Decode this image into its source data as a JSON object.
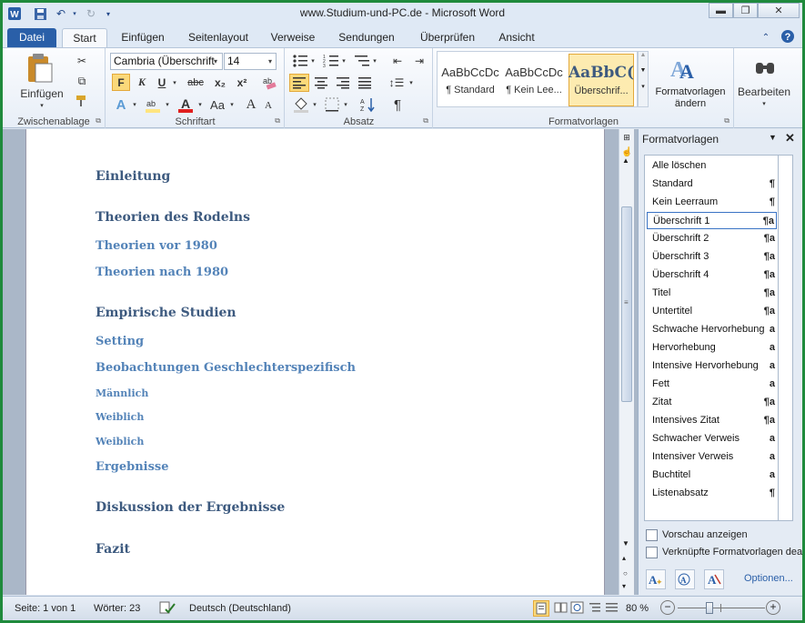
{
  "window": {
    "title": "www.Studium-und-PC.de  -  Microsoft Word"
  },
  "tabs": [
    "Datei",
    "Start",
    "Einfügen",
    "Seitenlayout",
    "Verweise",
    "Sendungen",
    "Überprüfen",
    "Ansicht"
  ],
  "ribbon": {
    "clipboard": {
      "paste_label": "Einfügen",
      "group_label": "Zwischenablage"
    },
    "font": {
      "font_name": "Cambria (Überschrift",
      "font_size": "14",
      "group_label": "Schriftart",
      "bold": "F",
      "italic": "K",
      "underline": "U",
      "strike": "abc",
      "sub": "x₂",
      "sup": "x²",
      "grow": "A",
      "shrink": "A",
      "case": "Aa"
    },
    "paragraph": {
      "group_label": "Absatz",
      "pilcrow": "¶"
    },
    "styles": {
      "group_label": "Formatvorlagen",
      "gallery": [
        {
          "preview": "AaBbCcDc",
          "name": "¶ Standard"
        },
        {
          "preview": "AaBbCcDc",
          "name": "¶ Kein Lee..."
        },
        {
          "preview": "AaBbC(",
          "name": "Überschrif..."
        }
      ],
      "change_styles_label": "Formatvorlagen ändern"
    },
    "editing": {
      "label": "Bearbeiten"
    }
  },
  "document": {
    "headings": [
      {
        "text": "Einleitung",
        "level": 1
      },
      {
        "text": "Theorien des Rodelns",
        "level": 1
      },
      {
        "text": "Theorien vor 1980",
        "level": 2
      },
      {
        "text": "Theorien nach 1980",
        "level": 2
      },
      {
        "text": "Empirische Studien",
        "level": 1
      },
      {
        "text": "Setting",
        "level": 2
      },
      {
        "text": "Beobachtungen Geschlechterspezifisch",
        "level": 2
      },
      {
        "text": "Männlich",
        "level": 3
      },
      {
        "text": "Weiblich",
        "level": 3
      },
      {
        "text": "Weiblich",
        "level": 3
      },
      {
        "text": "Ergebnisse",
        "level": 2
      },
      {
        "text": "Diskussion der Ergebnisse",
        "level": 1
      },
      {
        "text": "Fazit",
        "level": 1
      }
    ]
  },
  "styles_pane": {
    "title": "Formatvorlagen",
    "items": [
      {
        "name": "Alle löschen",
        "symbol": ""
      },
      {
        "name": "Standard",
        "symbol": "¶"
      },
      {
        "name": "Kein Leerraum",
        "symbol": "¶"
      },
      {
        "name": "Überschrift 1",
        "symbol": "¶a"
      },
      {
        "name": "Überschrift 2",
        "symbol": "¶a"
      },
      {
        "name": "Überschrift 3",
        "symbol": "¶a"
      },
      {
        "name": "Überschrift 4",
        "symbol": "¶a"
      },
      {
        "name": "Titel",
        "symbol": "¶a"
      },
      {
        "name": "Untertitel",
        "symbol": "¶a"
      },
      {
        "name": "Schwache Hervorhebung",
        "symbol": "a"
      },
      {
        "name": "Hervorhebung",
        "symbol": "a"
      },
      {
        "name": "Intensive Hervorhebung",
        "symbol": "a"
      },
      {
        "name": "Fett",
        "symbol": "a"
      },
      {
        "name": "Zitat",
        "symbol": "¶a"
      },
      {
        "name": "Intensives Zitat",
        "symbol": "¶a"
      },
      {
        "name": "Schwacher Verweis",
        "symbol": "a"
      },
      {
        "name": "Intensiver Verweis",
        "symbol": "a"
      },
      {
        "name": "Buchtitel",
        "symbol": "a"
      },
      {
        "name": "Listenabsatz",
        "symbol": "¶"
      }
    ],
    "selected": "Überschrift 1",
    "preview_label": "Vorschau anzeigen",
    "linked_label": "Verknüpfte Formatvorlagen dea",
    "options_label": "Optionen..."
  },
  "status": {
    "page": "Seite: 1 von 1",
    "words": "Wörter: 23",
    "language": "Deutsch (Deutschland)",
    "zoom": "80 %",
    "zoom_minus": "−",
    "zoom_plus": "+"
  },
  "colors": {
    "accent": "#2a5fa8",
    "heading1": "#3d5a7f",
    "heading2": "#5383b8",
    "highlight": "#ffe57f"
  },
  "icons": [
    "word-icon",
    "save-icon",
    "undo-icon",
    "redo-icon",
    "paste-icon",
    "cut-icon",
    "copy-icon",
    "format-painter-icon",
    "find-icon",
    "change-styles-icon"
  ]
}
